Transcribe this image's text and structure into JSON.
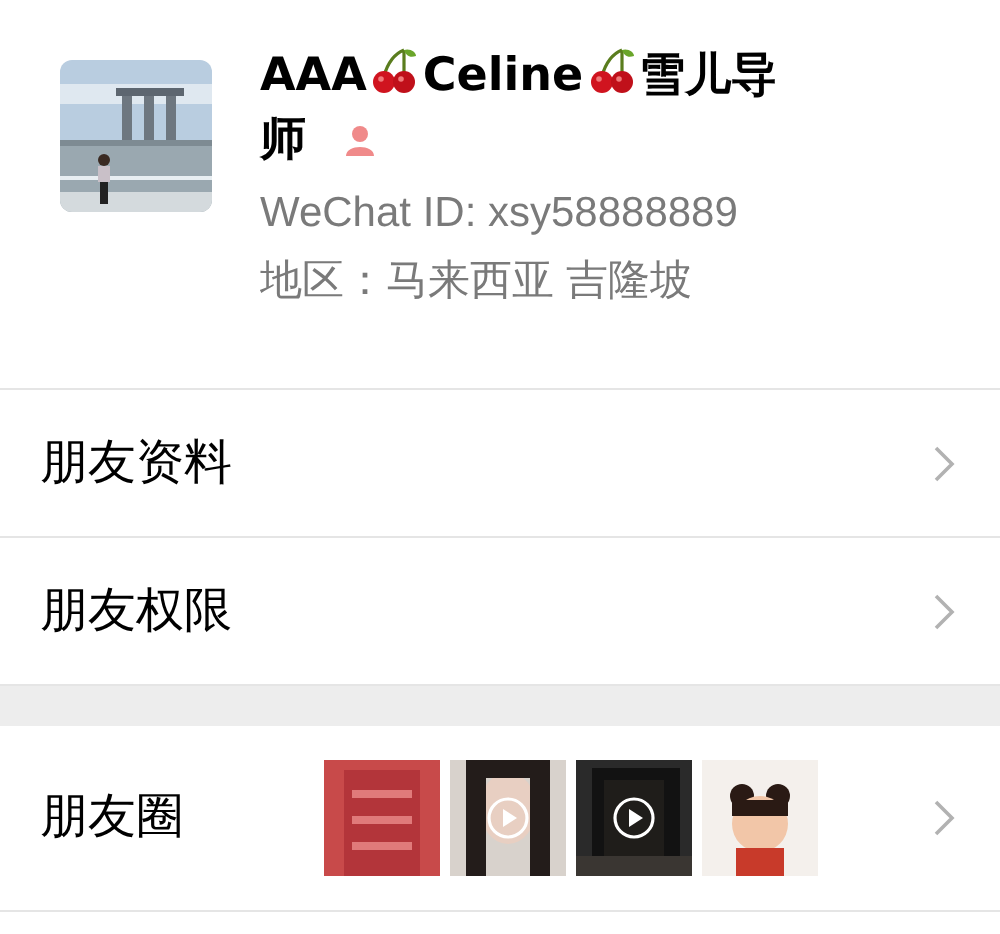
{
  "profile": {
    "name_segments": [
      {
        "kind": "text",
        "text": "AAA"
      },
      {
        "kind": "cherry"
      },
      {
        "kind": "text",
        "text": "Celine"
      },
      {
        "kind": "cherry"
      },
      {
        "kind": "text",
        "text": "雪儿导"
      },
      {
        "kind": "text",
        "text": "师"
      }
    ],
    "female": true,
    "wechat_id": "WeChat ID: xsy58888889",
    "region": "地区：马来西亚 吉隆坡"
  },
  "menu_items": [
    {
      "label": "朋友资料"
    },
    {
      "label": "朋友权限"
    }
  ],
  "moments": {
    "label": "朋友圈",
    "thumbnails": [
      {
        "kind": "picture",
        "video": false
      },
      {
        "kind": "picture",
        "video": true
      },
      {
        "kind": "picture",
        "video": true
      },
      {
        "kind": "picture",
        "video": false
      }
    ]
  }
}
